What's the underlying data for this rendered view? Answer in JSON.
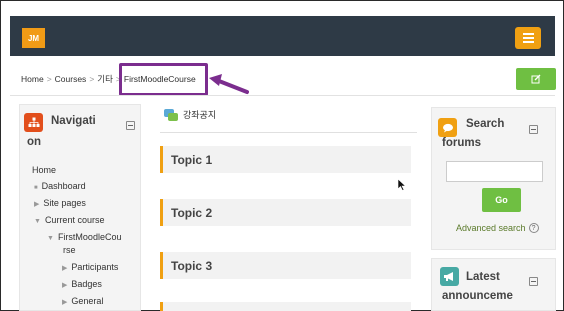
{
  "header": {
    "logo_text": "JM",
    "menu_icon": "hamburger-icon"
  },
  "breadcrumb": {
    "items": [
      "Home",
      "Courses",
      "기타",
      "FirstMoodleCourse"
    ],
    "separator": ">"
  },
  "edit_button": {
    "icon": "edit-icon"
  },
  "navigation": {
    "title_line1": "Navigati",
    "title_line2": "on",
    "items": {
      "home": "Home",
      "dashboard": "Dashboard",
      "site_pages": "Site pages",
      "current_course": "Current course",
      "course_line1": "FirstMoodleCou",
      "course_line2": "rse",
      "participants": "Participants",
      "badges": "Badges",
      "general": "General"
    }
  },
  "course": {
    "announcements": "강좌공지",
    "topics": [
      "Topic 1",
      "Topic 2",
      "Topic 3"
    ]
  },
  "search_forums": {
    "title_line1": "Search",
    "title_line2": "forums",
    "input_value": "",
    "go_label": "Go",
    "advanced_label": "Advanced search"
  },
  "latest": {
    "title_line1": "Latest",
    "title_line2": "announceme"
  },
  "colors": {
    "topbar": "#2e3a46",
    "accent_orange": "#f0a012",
    "accent_green": "#6fbf42",
    "highlight_purple": "#7b2d8e"
  }
}
